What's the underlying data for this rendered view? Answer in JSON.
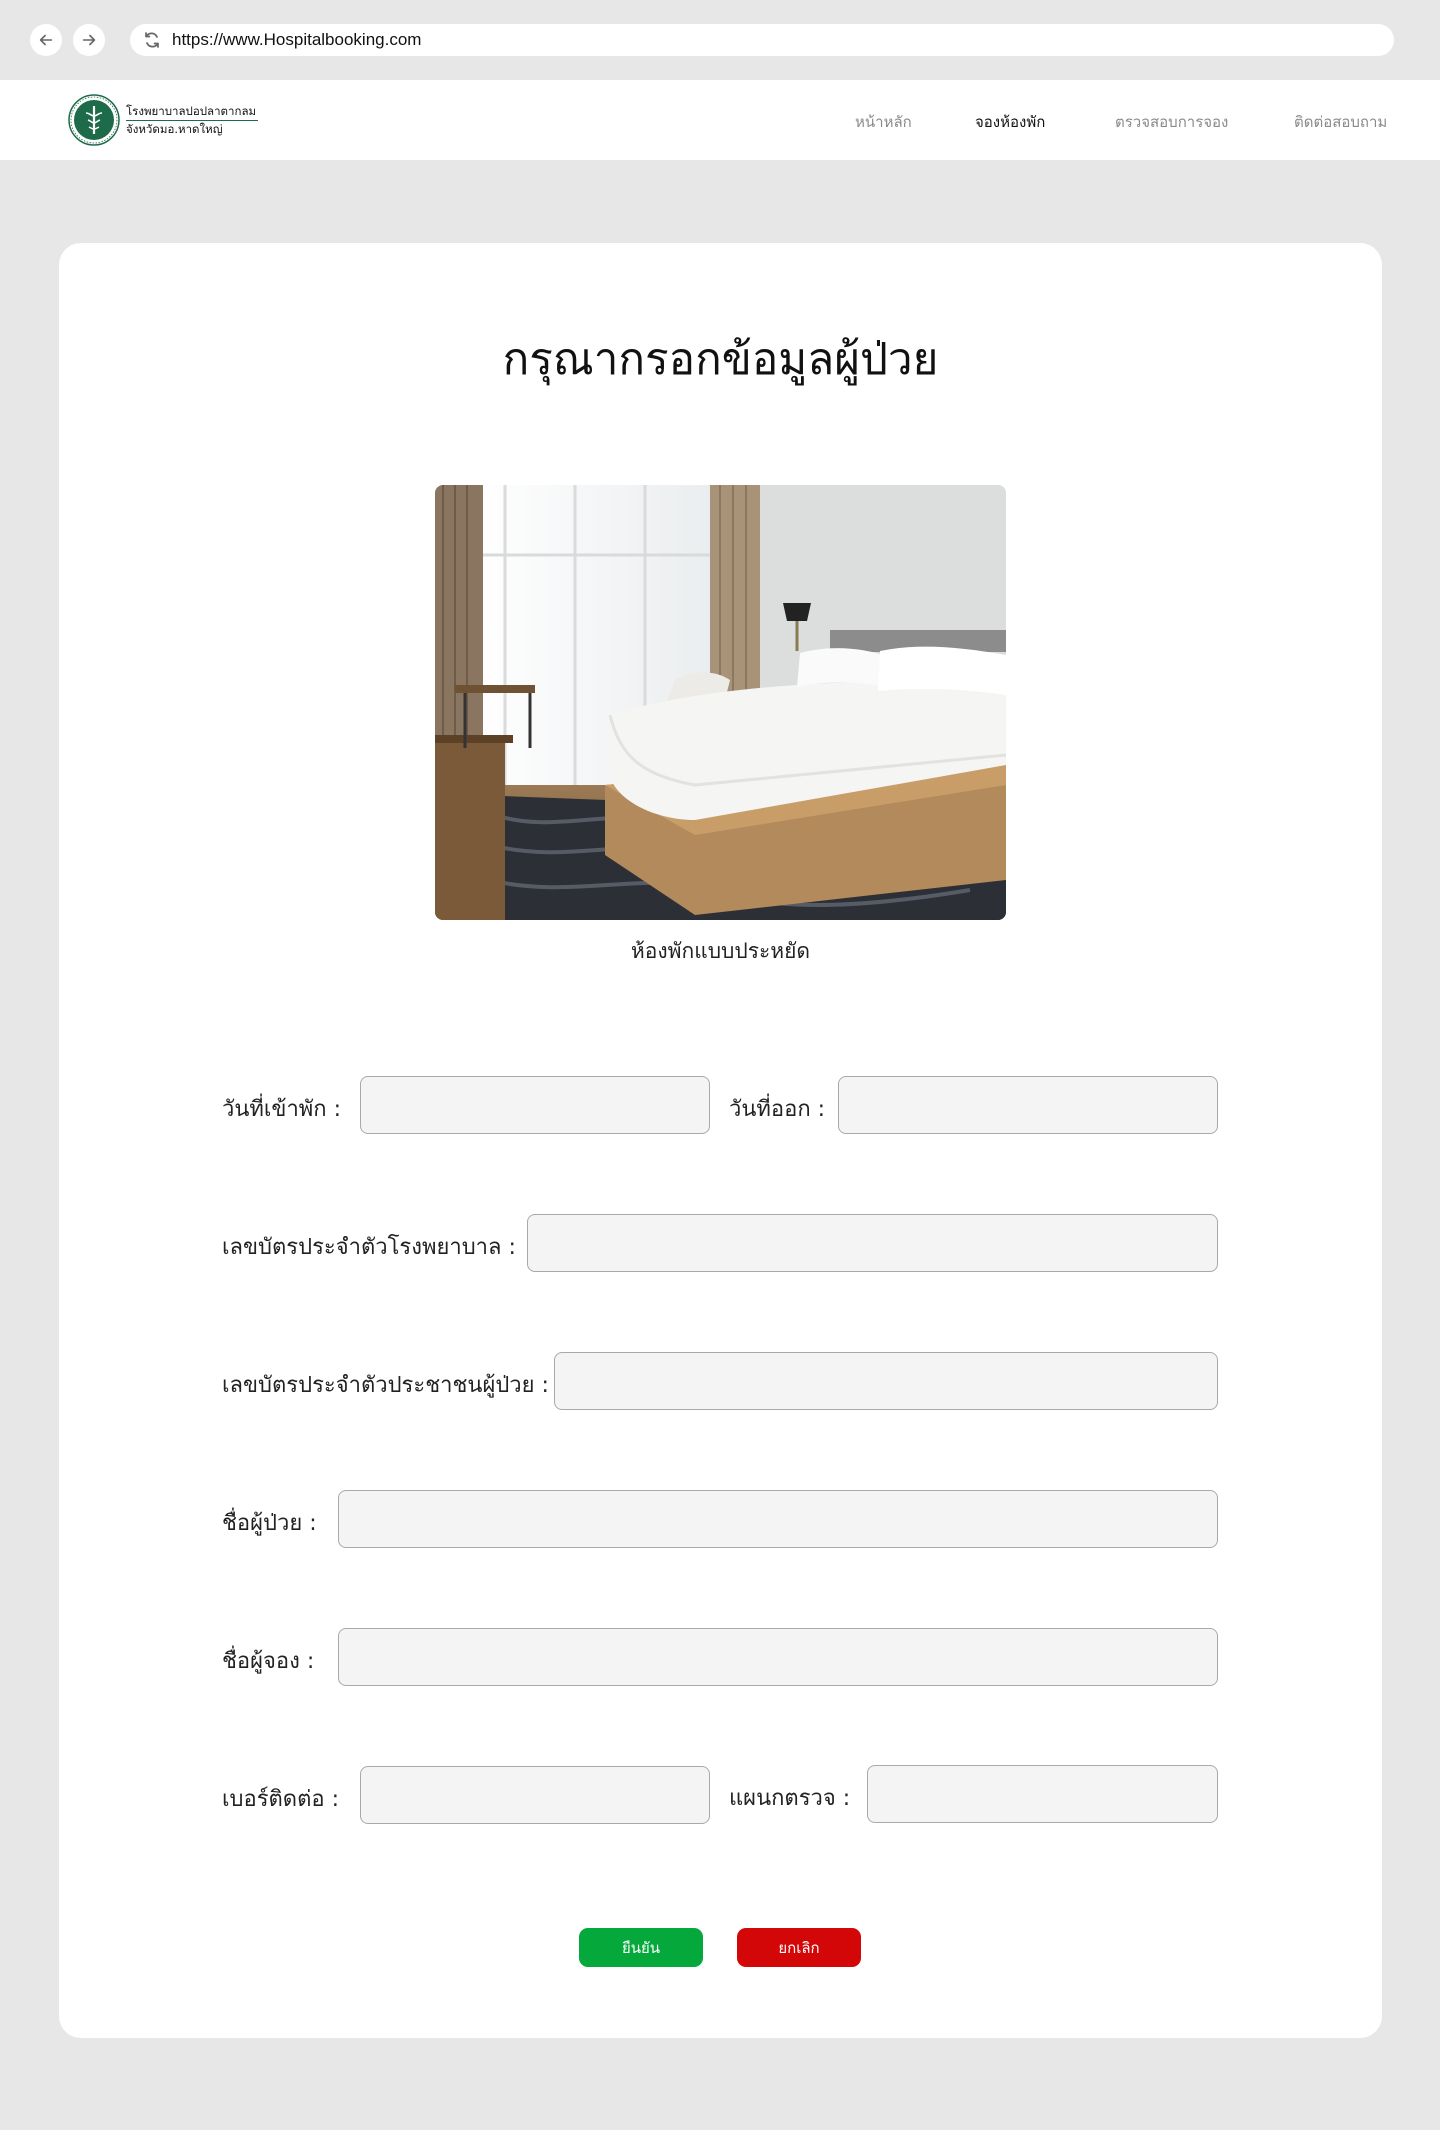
{
  "browser": {
    "url": "https://www.Hospitalbooking.com"
  },
  "header": {
    "logo_line1": "โรงพยาบาลปอปลาตากลม",
    "logo_line2": "จังหวัดมอ.หาดใหญ่",
    "nav": [
      {
        "label": "หน้าหลัก",
        "active": false
      },
      {
        "label": "จองห้องพัก",
        "active": true
      },
      {
        "label": "ตรวจสอบการจอง",
        "active": false
      },
      {
        "label": "ติดต่อสอบถาม",
        "active": false
      }
    ]
  },
  "form": {
    "title": "กรุณากรอกข้อมูลผู้ป่วย",
    "room_caption": "ห้องพักแบบประหยัด",
    "checkin_label": "วันที่เข้าพัก :",
    "checkout_label": "วันที่ออก :",
    "hospital_id_label": "เลขบัตรประจำตัวโรงพยาบาล :",
    "citizen_id_label": "เลขบัตรประจำตัวประชาชนผู้ป่วย :",
    "patient_name_label": "ชื่อผู้ป่วย :",
    "booker_name_label": "ชื่อผู้จอง :",
    "phone_label": "เบอร์ติดต่อ :",
    "department_label": "แผนกตรวจ :",
    "checkin_value": "",
    "checkout_value": "",
    "hospital_id_value": "",
    "citizen_id_value": "",
    "patient_name_value": "",
    "booker_name_value": "",
    "phone_value": "",
    "department_value": "",
    "confirm_label": "ยืนยัน",
    "cancel_label": "ยกเลิก"
  },
  "colors": {
    "confirm": "#05a83a",
    "cancel": "#d30707",
    "brand": "#1e6b4a"
  }
}
